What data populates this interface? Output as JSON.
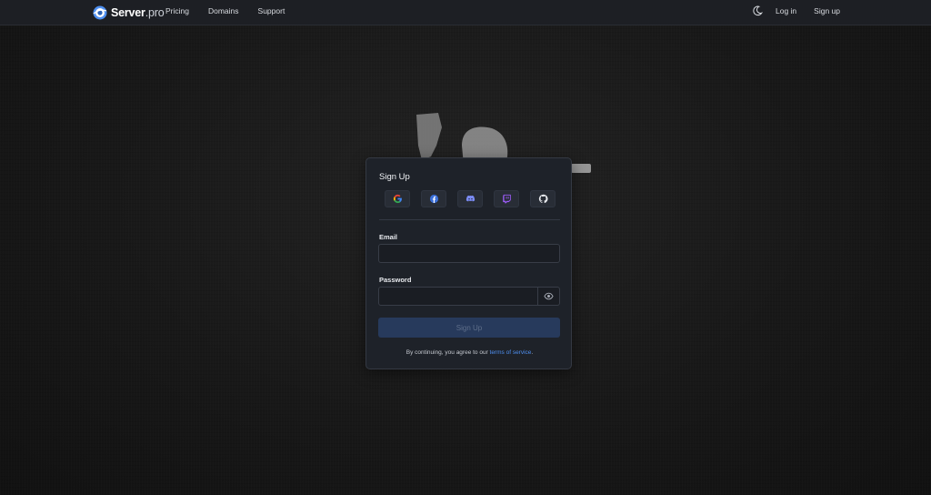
{
  "navbar": {
    "brand": {
      "name": "Server",
      "suffix": ".pro"
    },
    "links": [
      {
        "label": "Pricing"
      },
      {
        "label": "Domains"
      },
      {
        "label": "Support"
      }
    ],
    "theme_toggle_icon": "moon-icon",
    "login_label": "Log in",
    "signup_label": "Sign up"
  },
  "signup_card": {
    "title": "Sign Up",
    "social_providers": [
      {
        "name": "Google",
        "icon": "google-icon"
      },
      {
        "name": "Facebook",
        "icon": "facebook-icon"
      },
      {
        "name": "Discord",
        "icon": "discord-icon"
      },
      {
        "name": "Twitch",
        "icon": "twitch-icon"
      },
      {
        "name": "GitHub",
        "icon": "github-icon"
      }
    ],
    "email_label": "Email",
    "email_value": "",
    "password_label": "Password",
    "password_value": "",
    "password_toggle_icon": "eye-icon",
    "submit_label": "Sign Up",
    "terms_prefix": "By continuing, you agree to our ",
    "terms_link": "terms of service",
    "terms_suffix": "."
  },
  "colors": {
    "accent": "#4e8ff0",
    "submit_disabled": "#273a5c",
    "card_bg": "#1e2229",
    "navbar_bg": "#1d1f24"
  }
}
